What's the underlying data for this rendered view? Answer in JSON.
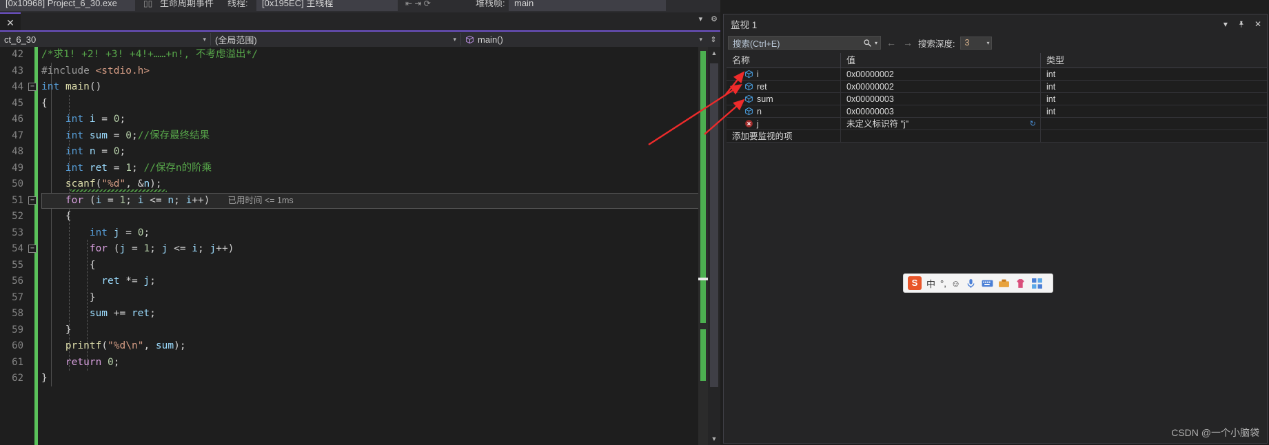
{
  "toolbar": {
    "process_chip": "[0x10968] Project_6_30.exe",
    "lifecycle_label": "生命周期事件",
    "thread_label": "线程:",
    "thread_chip": "[0x195EC] 主线程",
    "stackframe_label": "堆栈帧:",
    "stackframe_chip": "main"
  },
  "tabs": {
    "close_label": "✕"
  },
  "navbar": {
    "project": "ct_6_30",
    "scope": "(全局范围)",
    "function": "main()",
    "caret": "▾",
    "split_icon": "split-view-icon"
  },
  "editor": {
    "first_line": 42,
    "lines": [
      {
        "n": 42,
        "tokens": [
          {
            "c": "cm",
            "t": "/*求1! +2! +3! +4!+……+n!, 不考虑溢出*/"
          }
        ]
      },
      {
        "n": 43,
        "tokens": [
          {
            "c": "pp",
            "t": "#include "
          },
          {
            "c": "st",
            "t": "<stdio.h>"
          }
        ]
      },
      {
        "n": 44,
        "fold": true,
        "tokens": [
          {
            "c": "k",
            "t": "int"
          },
          {
            "c": "pl",
            "t": " "
          },
          {
            "c": "fn",
            "t": "main"
          },
          {
            "c": "pl",
            "t": "()"
          }
        ]
      },
      {
        "n": 45,
        "tokens": [
          {
            "c": "pl",
            "t": "{"
          }
        ]
      },
      {
        "n": 46,
        "tokens": [
          {
            "c": "k",
            "t": "    int"
          },
          {
            "c": "pl",
            "t": " "
          },
          {
            "c": "id",
            "t": "i"
          },
          {
            "c": "pl",
            "t": " = "
          },
          {
            "c": "num",
            "t": "0"
          },
          {
            "c": "pl",
            "t": ";"
          }
        ]
      },
      {
        "n": 47,
        "tokens": [
          {
            "c": "k",
            "t": "    int"
          },
          {
            "c": "pl",
            "t": " "
          },
          {
            "c": "id",
            "t": "sum"
          },
          {
            "c": "pl",
            "t": " = "
          },
          {
            "c": "num",
            "t": "0"
          },
          {
            "c": "pl",
            "t": ";"
          },
          {
            "c": "cm",
            "t": "//保存最终结果"
          }
        ]
      },
      {
        "n": 48,
        "tokens": [
          {
            "c": "k",
            "t": "    int"
          },
          {
            "c": "pl",
            "t": " "
          },
          {
            "c": "id",
            "t": "n"
          },
          {
            "c": "pl",
            "t": " = "
          },
          {
            "c": "num",
            "t": "0"
          },
          {
            "c": "pl",
            "t": ";"
          }
        ]
      },
      {
        "n": 49,
        "tokens": [
          {
            "c": "k",
            "t": "    int"
          },
          {
            "c": "pl",
            "t": " "
          },
          {
            "c": "id",
            "t": "ret"
          },
          {
            "c": "pl",
            "t": " = "
          },
          {
            "c": "num",
            "t": "1"
          },
          {
            "c": "pl",
            "t": "; "
          },
          {
            "c": "cm",
            "t": "//保存n的阶乘"
          }
        ]
      },
      {
        "n": 50,
        "squiggle": true,
        "tokens": [
          {
            "c": "fn",
            "t": "    scanf"
          },
          {
            "c": "pl",
            "t": "("
          },
          {
            "c": "st",
            "t": "\"%d\""
          },
          {
            "c": "pl",
            "t": ", &"
          },
          {
            "c": "id",
            "t": "n"
          },
          {
            "c": "pl",
            "t": ");"
          }
        ]
      },
      {
        "n": 51,
        "fold": true,
        "current": true,
        "timing": "已用时间 <= 1ms",
        "tokens": [
          {
            "c": "kc",
            "t": "    for"
          },
          {
            "c": "pl",
            "t": " ("
          },
          {
            "c": "id",
            "t": "i"
          },
          {
            "c": "pl",
            "t": " = "
          },
          {
            "c": "num",
            "t": "1"
          },
          {
            "c": "pl",
            "t": "; "
          },
          {
            "c": "id",
            "t": "i"
          },
          {
            "c": "pl",
            "t": " <= "
          },
          {
            "c": "id",
            "t": "n"
          },
          {
            "c": "pl",
            "t": "; "
          },
          {
            "c": "id",
            "t": "i"
          },
          {
            "c": "pl",
            "t": "++)"
          }
        ]
      },
      {
        "n": 52,
        "tokens": [
          {
            "c": "pl",
            "t": "    {"
          }
        ]
      },
      {
        "n": 53,
        "tokens": [
          {
            "c": "k",
            "t": "        int"
          },
          {
            "c": "pl",
            "t": " "
          },
          {
            "c": "id",
            "t": "j"
          },
          {
            "c": "pl",
            "t": " = "
          },
          {
            "c": "num",
            "t": "0"
          },
          {
            "c": "pl",
            "t": ";"
          }
        ]
      },
      {
        "n": 54,
        "fold": true,
        "tokens": [
          {
            "c": "kc",
            "t": "        for"
          },
          {
            "c": "pl",
            "t": " ("
          },
          {
            "c": "id",
            "t": "j"
          },
          {
            "c": "pl",
            "t": " = "
          },
          {
            "c": "num",
            "t": "1"
          },
          {
            "c": "pl",
            "t": "; "
          },
          {
            "c": "id",
            "t": "j"
          },
          {
            "c": "pl",
            "t": " <= "
          },
          {
            "c": "id",
            "t": "i"
          },
          {
            "c": "pl",
            "t": "; "
          },
          {
            "c": "id",
            "t": "j"
          },
          {
            "c": "pl",
            "t": "++)"
          }
        ]
      },
      {
        "n": 55,
        "tokens": [
          {
            "c": "pl",
            "t": "        {"
          }
        ]
      },
      {
        "n": 56,
        "tokens": [
          {
            "c": "id",
            "t": "          ret"
          },
          {
            "c": "pl",
            "t": " *= "
          },
          {
            "c": "id",
            "t": "j"
          },
          {
            "c": "pl",
            "t": ";"
          }
        ]
      },
      {
        "n": 57,
        "tokens": [
          {
            "c": "pl",
            "t": "        }"
          }
        ]
      },
      {
        "n": 58,
        "tokens": [
          {
            "c": "id",
            "t": "        sum"
          },
          {
            "c": "pl",
            "t": " += "
          },
          {
            "c": "id",
            "t": "ret"
          },
          {
            "c": "pl",
            "t": ";"
          }
        ]
      },
      {
        "n": 59,
        "tokens": [
          {
            "c": "pl",
            "t": "    }"
          }
        ]
      },
      {
        "n": 60,
        "tokens": [
          {
            "c": "fn",
            "t": "    printf"
          },
          {
            "c": "pl",
            "t": "("
          },
          {
            "c": "st",
            "t": "\"%d\\n\""
          },
          {
            "c": "pl",
            "t": ", "
          },
          {
            "c": "id",
            "t": "sum"
          },
          {
            "c": "pl",
            "t": ");"
          }
        ]
      },
      {
        "n": 61,
        "tokens": [
          {
            "c": "kc",
            "t": "    return"
          },
          {
            "c": "pl",
            "t": " "
          },
          {
            "c": "num",
            "t": "0"
          },
          {
            "c": "pl",
            "t": ";"
          }
        ]
      },
      {
        "n": 62,
        "tokens": [
          {
            "c": "pl",
            "t": "}"
          }
        ]
      }
    ]
  },
  "watch": {
    "title": "监视 1",
    "controls": {
      "dropdown": "▾",
      "pin": "pin-icon",
      "close": "✕"
    },
    "search_placeholder": "搜索(Ctrl+E)",
    "search_icon": "magnifier-icon",
    "search_caret": "▾",
    "prev_arrow": "←",
    "next_arrow": "→",
    "depth_label": "搜索深度:",
    "depth_value": "3",
    "depth_caret": "▾",
    "columns": [
      "名称",
      "值",
      "类型"
    ],
    "rows": [
      {
        "name": "i",
        "value": "0x00000002",
        "type": "int",
        "icon": "cube-icon"
      },
      {
        "name": "ret",
        "value": "0x00000002",
        "type": "int",
        "icon": "cube-icon"
      },
      {
        "name": "sum",
        "value": "0x00000003",
        "type": "int",
        "icon": "cube-icon"
      },
      {
        "name": "n",
        "value": "0x00000003",
        "type": "int",
        "icon": "cube-icon"
      },
      {
        "name": "j",
        "value": "未定义标识符 \"j\"",
        "type": "",
        "icon": "error-icon",
        "error": true,
        "refresh": "↻"
      }
    ],
    "add_row_placeholder": "添加要监视的项"
  },
  "ime": {
    "logo": "S",
    "mode": "中",
    "punct": "°,",
    "emoji": "☺",
    "mic": "mic-icon",
    "keyboard": "keyboard-icon",
    "tools": "toolbox-icon",
    "skin": "skin-icon",
    "apps": "apps-icon"
  },
  "watermark": "CSDN @一个小脑袋",
  "colors": {
    "accent_purple": "#6f52c9",
    "change_green": "#5ac15a",
    "arrow_red": "#ee2b2b",
    "error_red": "#a02c2c",
    "cube_blue": "#4a9fe0"
  }
}
